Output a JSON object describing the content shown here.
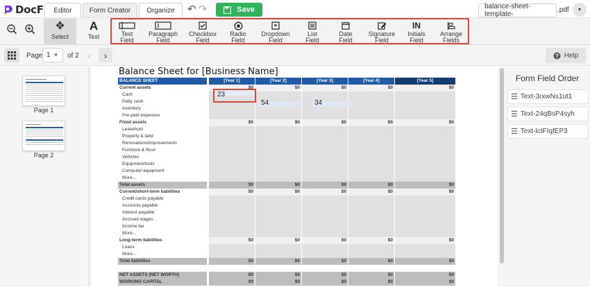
{
  "app": {
    "name": "DocFly"
  },
  "tabs": [
    {
      "label": "Editor"
    },
    {
      "label": "Form Creator"
    },
    {
      "label": "Organize"
    }
  ],
  "save": {
    "label": "Save"
  },
  "file": {
    "name": "balance-sheet-template-",
    "ext": ".pdf"
  },
  "tools": {
    "select": "Select",
    "text": "Text",
    "text_field": "Text Field",
    "paragraph_field": "Paragraph Field",
    "checkbox_field": "Checkbox Field",
    "radio_field": "Radio Field",
    "dropdown_field": "Dropdown Field",
    "list_field": "List Field",
    "date_field": "Date Field",
    "signature_field": "Signature Field",
    "initials_field": "Initials Field",
    "arrange_fields": "Arrange Fields"
  },
  "pager": {
    "page_label": "Page",
    "current": "1",
    "of": "of 2"
  },
  "help": {
    "label": "Help"
  },
  "thumbnails": [
    {
      "label": "Page 1"
    },
    {
      "label": "Page 2"
    }
  ],
  "document": {
    "title": "Balance Sheet for [Business Name]",
    "header": {
      "label": "BALANCE SHEET",
      "years": [
        "[Year 1]",
        "[Year 2]",
        "[Year 3]",
        "[Year 4]",
        "[Year 5]"
      ]
    },
    "rows": [
      {
        "label": "Current assets",
        "type": "section",
        "values": [
          "$0",
          "$0",
          "$0",
          "$0",
          "$0"
        ]
      },
      {
        "label": "Cash",
        "type": "item"
      },
      {
        "label": "Petty cash",
        "type": "item"
      },
      {
        "label": "Inventory",
        "type": "item"
      },
      {
        "label": "Pre-paid expenses",
        "type": "item"
      },
      {
        "label": "Fixed assets",
        "type": "section",
        "values": [
          "$0",
          "$0",
          "$0",
          "$0",
          "$0"
        ]
      },
      {
        "label": "Leasehold",
        "type": "item"
      },
      {
        "label": "Property & land",
        "type": "item"
      },
      {
        "label": "Renovations/improvements",
        "type": "item"
      },
      {
        "label": "Furniture & fitout",
        "type": "item"
      },
      {
        "label": "Vehicles",
        "type": "item"
      },
      {
        "label": "Equipment/tools",
        "type": "item"
      },
      {
        "label": "Computer equipment",
        "type": "item"
      },
      {
        "label": "More...",
        "type": "item"
      },
      {
        "label": "Total assets",
        "type": "total",
        "values": [
          "$0",
          "$0",
          "$0",
          "$0",
          "$0"
        ]
      },
      {
        "label": "Current/short-term liabilities",
        "type": "section",
        "values": [
          "$0",
          "$0",
          "$0",
          "$0",
          "$0"
        ]
      },
      {
        "label": "Credit cards payable",
        "type": "item"
      },
      {
        "label": "Accounts payable",
        "type": "item"
      },
      {
        "label": "Interest payable",
        "type": "item"
      },
      {
        "label": "Accrued wages",
        "type": "item"
      },
      {
        "label": "Income tax",
        "type": "item"
      },
      {
        "label": "More...",
        "type": "item"
      },
      {
        "label": "Long-term liabilities",
        "type": "section",
        "values": [
          "$0",
          "$0",
          "$0",
          "$0",
          "$0"
        ]
      },
      {
        "label": "Loans",
        "type": "item"
      },
      {
        "label": "More...",
        "type": "item"
      },
      {
        "label": "Total liabilities",
        "type": "total",
        "values": [
          "$0",
          "$0",
          "$0",
          "$0",
          "$0"
        ]
      },
      {
        "label": "",
        "type": "blank"
      },
      {
        "label": "NET ASSETS (NET WORTH)",
        "type": "total",
        "values": [
          "$0",
          "$0",
          "$0",
          "$0",
          "$0"
        ]
      },
      {
        "label": "WORKING CAPITAL",
        "type": "total",
        "values": [
          "$0",
          "$0",
          "$0",
          "$0",
          "$0"
        ]
      }
    ],
    "field_values": {
      "cash_year1": "23",
      "petty_cash_year2": "54",
      "petty_cash_year3": "34"
    }
  },
  "form_field_order": {
    "title": "Form Field Order",
    "items": [
      "Text-3rxwNs1ut1",
      "Text-24qBsP4syh",
      "Text-lcIFIqfEP3"
    ]
  },
  "colors": {
    "accent": "#2fb457",
    "header_blue": "#1f5ba9",
    "highlight": "#d4493a"
  }
}
